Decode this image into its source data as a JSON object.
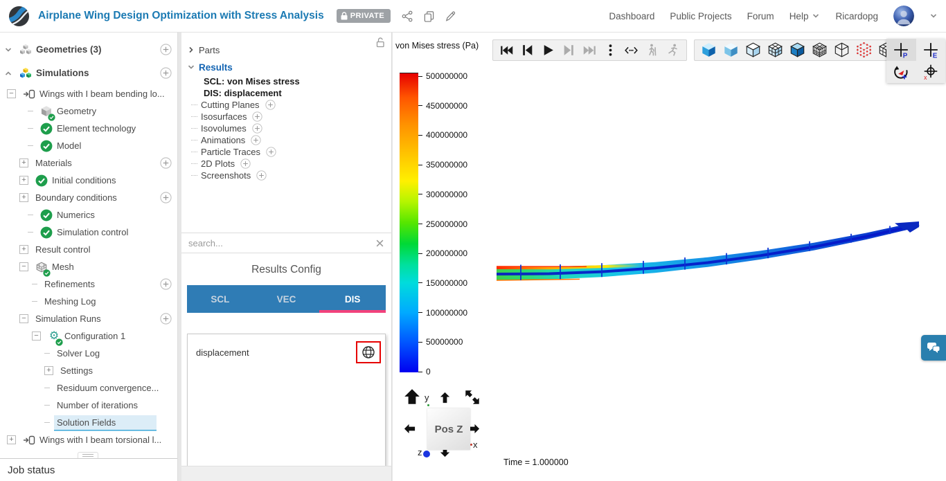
{
  "header": {
    "title": "Airplane Wing Design Optimization with Stress Analysis",
    "privacy_badge": "PRIVATE",
    "action_icons": [
      "share-icon",
      "copy-icon",
      "edit-icon"
    ],
    "nav_items": [
      "Dashboard",
      "Public Projects",
      "Forum",
      "Help",
      "Ricardopg"
    ],
    "accent_color": "#1b7ab3"
  },
  "sidebar": {
    "items": [
      {
        "label": "Geometries (3)",
        "lvl": 0,
        "exp": "chev-down",
        "icon": "cubes-gray",
        "plus": true
      },
      {
        "label": "Simulations",
        "lvl": 0,
        "exp": "chev-up",
        "icon": "cubes-color",
        "plus": true
      },
      {
        "label": "Wings with I beam bending lo...",
        "lvl": 1,
        "exp": "minus",
        "icon": "sim"
      },
      {
        "label": "Geometry",
        "lvl": 3,
        "exp": "dash",
        "icon": "cube-check"
      },
      {
        "label": "Element technology",
        "lvl": 3,
        "exp": "dash",
        "icon": "check"
      },
      {
        "label": "Model",
        "lvl": 3,
        "exp": "dash",
        "icon": "check"
      },
      {
        "label": "Materials",
        "lvl": 2,
        "exp": "plus",
        "plus": true
      },
      {
        "label": "Initial conditions",
        "lvl": 2,
        "exp": "plus",
        "icon": "check"
      },
      {
        "label": "Boundary conditions",
        "lvl": 2,
        "exp": "plus",
        "plus": true
      },
      {
        "label": "Numerics",
        "lvl": 3,
        "exp": "dash",
        "icon": "check"
      },
      {
        "label": "Simulation control",
        "lvl": 3,
        "exp": "dash",
        "icon": "check"
      },
      {
        "label": "Result control",
        "lvl": 2,
        "exp": "plus"
      },
      {
        "label": "Mesh",
        "lvl": 2,
        "exp": "minus",
        "icon": "mesh-check"
      },
      {
        "label": "Refinements",
        "lvl": 4,
        "exp": "dash",
        "plus": true
      },
      {
        "label": "Meshing Log",
        "lvl": 4,
        "exp": "dash"
      },
      {
        "label": "Simulation Runs",
        "lvl": 2,
        "exp": "minus",
        "plus": true
      },
      {
        "label": "Configuration 1",
        "lvl": 4,
        "exp": "minus",
        "icon": "gear-check"
      },
      {
        "label": "Solver Log",
        "lvl": 5,
        "exp": "dash"
      },
      {
        "label": "Settings",
        "lvl": 5,
        "exp": "plus"
      },
      {
        "label": "Residuum convergence...",
        "lvl": 5,
        "exp": "dash"
      },
      {
        "label": "Number of iterations",
        "lvl": 5,
        "exp": "dash"
      },
      {
        "label": "Solution Fields",
        "lvl": 5,
        "exp": "dash",
        "selected": true
      },
      {
        "label": "Wings with I beam torsional l...",
        "lvl": 1,
        "exp": "plus",
        "icon": "sim"
      }
    ],
    "job_status_label": "Job status"
  },
  "posttree": {
    "items": [
      {
        "label": "Parts",
        "exp": "chev-right",
        "cls": "row-parts"
      },
      {
        "label": "Results",
        "exp": "chev-down",
        "cls": "row-results"
      },
      {
        "label": "SCL: von Mises stress",
        "cls": "row-field"
      },
      {
        "label": "DIS: displacement",
        "cls": "row-field"
      },
      {
        "label": "Cutting Planes",
        "plus": true
      },
      {
        "label": "Isosurfaces",
        "plus": true
      },
      {
        "label": "Isovolumes",
        "plus": true
      },
      {
        "label": "Animations",
        "plus": true
      },
      {
        "label": "Particle Traces",
        "plus": true
      },
      {
        "label": "2D Plots",
        "plus": true
      },
      {
        "label": "Screenshots",
        "plus": true
      }
    ],
    "search_placeholder": "search..."
  },
  "results_config": {
    "title": "Results Config",
    "tabs": [
      {
        "label": "SCL"
      },
      {
        "label": "VEC"
      },
      {
        "label": "DIS",
        "active": true
      }
    ],
    "active_underline_color": "#f2427c",
    "fields": [
      {
        "label": "displacement",
        "icon": "globe-icon",
        "annotated": true
      }
    ]
  },
  "viewer": {
    "colorbar": {
      "title": "von Mises stress (Pa)",
      "ticks": [
        "500000000",
        "450000000",
        "400000000",
        "350000000",
        "300000000",
        "250000000",
        "200000000",
        "150000000",
        "100000000",
        "50000000",
        "0"
      ]
    },
    "playback": [
      {
        "name": "skip-start",
        "enabled": true
      },
      {
        "name": "step-back",
        "enabled": true
      },
      {
        "name": "play",
        "enabled": true
      },
      {
        "name": "step-forward",
        "enabled": false
      },
      {
        "name": "skip-end",
        "enabled": false
      },
      {
        "name": "menu-dots",
        "enabled": true
      },
      {
        "name": "time-range",
        "enabled": true
      },
      {
        "name": "walk",
        "enabled": false
      },
      {
        "name": "run",
        "enabled": false
      }
    ],
    "render_modes": [
      "cube-shaded",
      "cube-smooth",
      "cube-surface",
      "cube-surface-mesh",
      "cube-solid",
      "cube-mesh",
      "cube-wireframe",
      "cube-points",
      "cube-grid"
    ],
    "probe_panel": [
      {
        "name": "probe-point",
        "letter": "P",
        "selected": true
      },
      {
        "name": "probe-element",
        "letter": "E"
      },
      {
        "name": "rotate-reset"
      },
      {
        "name": "center-axis"
      }
    ],
    "nav_cube": {
      "face": "Pos Z",
      "axis_x": "x",
      "axis_y": "y",
      "axis_z": "z"
    },
    "time_label": "Time = 1.000000"
  }
}
